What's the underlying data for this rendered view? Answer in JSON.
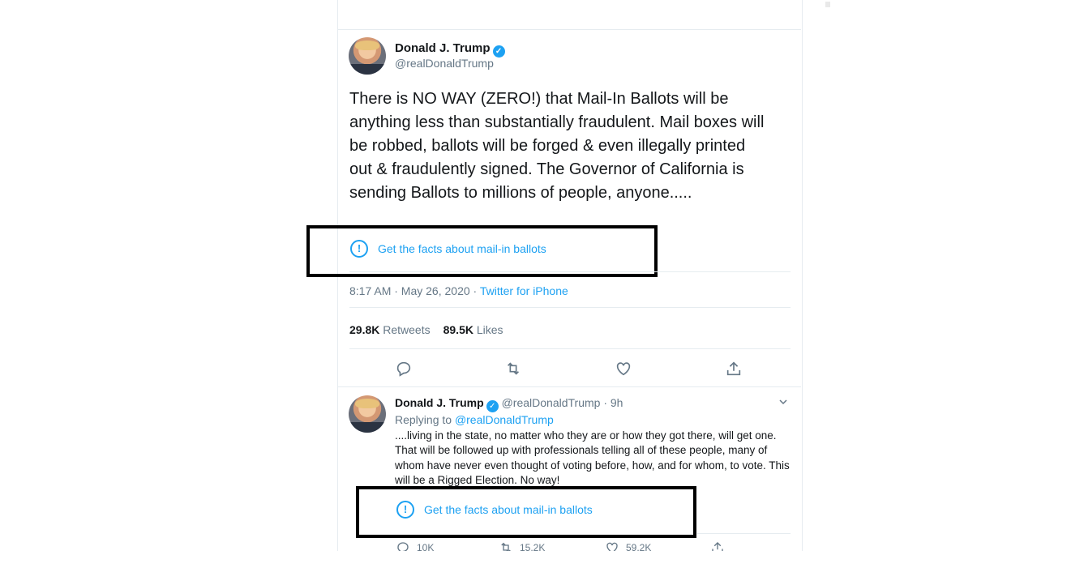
{
  "tweet": {
    "author_name": "Donald J. Trump",
    "author_handle": "@realDonaldTrump",
    "text": "There is NO WAY (ZERO!) that Mail-In Ballots will be anything less than substantially fraudulent. Mail boxes will be robbed, ballots will be forged & even illegally printed out & fraudulently signed. The Governor of California is sending Ballots to millions of people, anyone.....",
    "fact_check_label": "Get the facts about mail-in ballots",
    "timestamp": "8:17 AM · May 26, 2020 · ",
    "source": "Twitter for iPhone",
    "retweets_count": "29.8K",
    "retweets_label": "Retweets",
    "likes_count": "89.5K",
    "likes_label": "Likes"
  },
  "reply_tweet": {
    "author_name": "Donald J. Trump",
    "meta": "@realDonaldTrump · 9h",
    "replying_prefix": "Replying to ",
    "replying_to": "@realDonaldTrump",
    "text": "....living in the state, no matter who they are or how they got there, will get one. That will be followed up with professionals telling all of these people, many of whom have never even thought of voting before, how, and for whom, to vote. This will be a Rigged Election. No way!",
    "fact_check_label": "Get the facts about mail-in ballots",
    "reply_count": "10K",
    "retweet_count": "15.2K",
    "like_count": "59.2K"
  },
  "icons": {
    "verified": "verified-badge-icon",
    "fact_check": "exclamation-circle-icon",
    "reply": "comment-icon",
    "retweet": "retweet-icon",
    "like": "heart-icon",
    "share": "share-icon",
    "more": "chevron-down-icon"
  },
  "colors": {
    "accent": "#1da1f2",
    "text": "#14171a",
    "muted": "#657786",
    "highlight_border": "#000000"
  }
}
